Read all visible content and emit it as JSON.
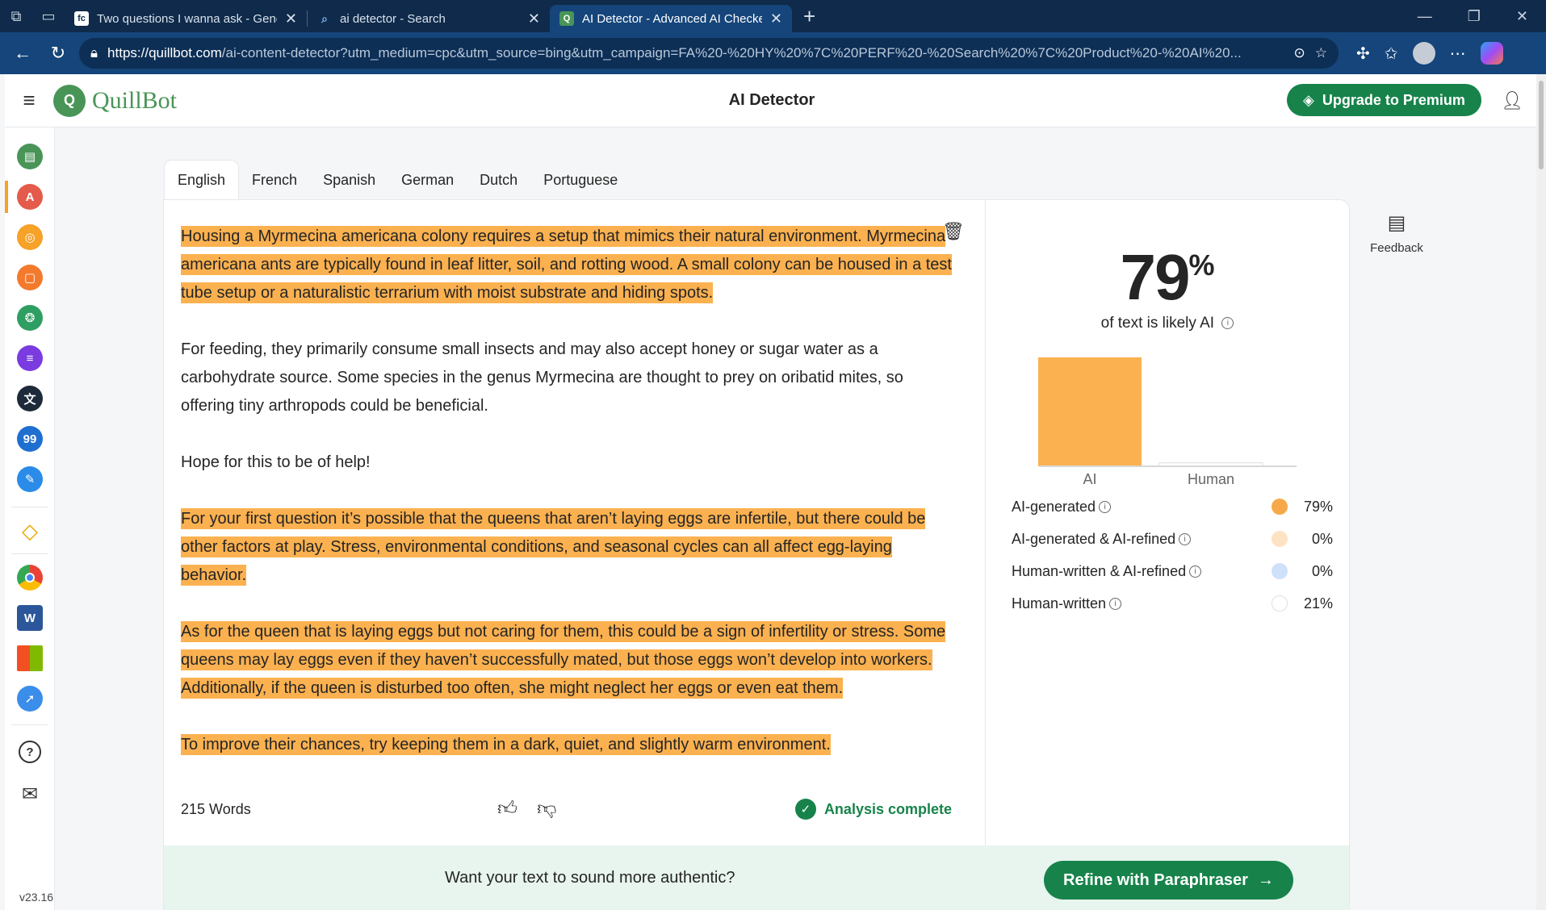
{
  "browser": {
    "tabs": [
      {
        "title": "Two questions I wanna ask - Gene",
        "favicon": "fc"
      },
      {
        "title": "ai detector - Search",
        "favicon": "search"
      },
      {
        "title": "AI Detector - Advanced AI Checke",
        "favicon": "quillbot"
      }
    ],
    "url": {
      "host": "https://quillbot.com",
      "path": "/ai-content-detector?utm_medium=cpc&utm_source=bing&utm_campaign=FA%20-%20HY%20%7C%20PERF%20-%20Search%20%7C%20Product%20-%20AI%20..."
    }
  },
  "header": {
    "brand": "QuillBot",
    "title": "AI Detector",
    "upgrade_label": "Upgrade to Premium"
  },
  "languages": [
    "English",
    "French",
    "Spanish",
    "German",
    "Dutch",
    "Portuguese"
  ],
  "editor": {
    "paragraphs": [
      {
        "highlight": true,
        "text": "Housing a Myrmecina americana colony requires a setup that mimics their natural environment. Myrmecina americana ants are typically found in leaf litter, soil, and rotting wood. A small colony can be housed in a test tube setup or a naturalistic terrarium with moist substrate and hiding spots."
      },
      {
        "highlight": false,
        "text": "For feeding, they primarily consume small insects and may also accept honey or sugar water as a carbohydrate source. Some species in the genus Myrmecina are thought to prey on oribatid mites, so offering tiny arthropods could be beneficial."
      },
      {
        "highlight": false,
        "text": "Hope for this to be of help!"
      },
      {
        "highlight": true,
        "text": "For your first question it’s possible that the queens that aren’t laying eggs are infertile, but there could be other factors at play. Stress, environmental conditions, and seasonal cycles can all affect egg-laying behavior."
      },
      {
        "highlight": true,
        "text": "As for the queen that is laying eggs but not caring for them, this could be a sign of infertility or stress. Some queens may lay eggs even if they haven’t successfully mated, but those eggs won’t develop into workers. Additionally, if the queen is disturbed too often, she might neglect her eggs or even eat them."
      },
      {
        "highlight": true,
        "text": "To improve their chances, try keeping them in a dark, quiet, and slightly warm environment."
      }
    ],
    "word_count": "215 Words",
    "status": "Analysis complete"
  },
  "results": {
    "percent": "79",
    "percent_symbol": "%",
    "likely_label": "of text is likely AI",
    "legend": [
      {
        "label": "AI-generated",
        "value": "79%",
        "color": "#f6a94a"
      },
      {
        "label": "AI-generated & AI-refined",
        "value": "0%",
        "color": "#fde3c4"
      },
      {
        "label": "Human-written & AI-refined",
        "value": "0%",
        "color": "#cfe0fb"
      },
      {
        "label": "Human-written",
        "value": "21%",
        "color": "#ffffff"
      }
    ]
  },
  "chart_data": {
    "type": "bar",
    "categories": [
      "AI",
      "Human"
    ],
    "values": [
      79,
      21
    ],
    "colors": [
      "#fbb150",
      "#ffffff"
    ],
    "ylim": [
      0,
      100
    ]
  },
  "banner": {
    "text": "Want your text to sound more authentic?",
    "button_label": "Refine with Paraphraser"
  },
  "feedback_label": "Feedback",
  "version": "v23.16",
  "colors": {
    "brand_green": "#17834b",
    "highlight": "#fbb150",
    "chrome_dark": "#0f2a4a",
    "chrome_blue": "#15457a"
  }
}
